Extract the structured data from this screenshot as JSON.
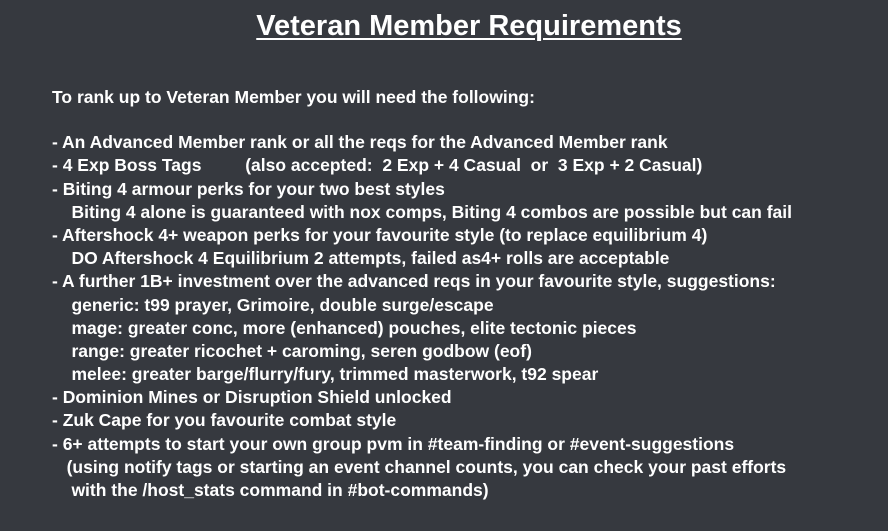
{
  "title": "Veteran Member Requirements",
  "intro": "To rank up to Veteran Member you will need the following:",
  "lines": [
    "- An Advanced Member rank or all the reqs for the Advanced Member rank",
    "- 4 Exp Boss Tags         (also accepted:  2 Exp + 4 Casual  or  3 Exp + 2 Casual)",
    "- Biting 4 armour perks for your two best styles",
    "    Biting 4 alone is guaranteed with nox comps, Biting 4 combos are possible but can fail",
    "- Aftershock 4+ weapon perks for your favourite style (to replace equilibrium 4)",
    "    DO Aftershock 4 Equilibrium 2 attempts, failed as4+ rolls are acceptable",
    "- A further 1B+ investment over the advanced reqs in your favourite style, suggestions:",
    "    generic: t99 prayer, Grimoire, double surge/escape",
    "    mage: greater conc, more (enhanced) pouches, elite tectonic pieces",
    "    range: greater ricochet + caroming, seren godbow (eof)",
    "    melee: greater barge/flurry/fury, trimmed masterwork, t92 spear",
    "- Dominion Mines or Disruption Shield unlocked",
    "- Zuk Cape for you favourite combat style",
    "- 6+ attempts to start your own group pvm in #team-finding or #event-suggestions",
    "   (using notify tags or starting an event channel counts, you can check your past efforts",
    "    with the /host_stats command in #bot-commands)"
  ]
}
